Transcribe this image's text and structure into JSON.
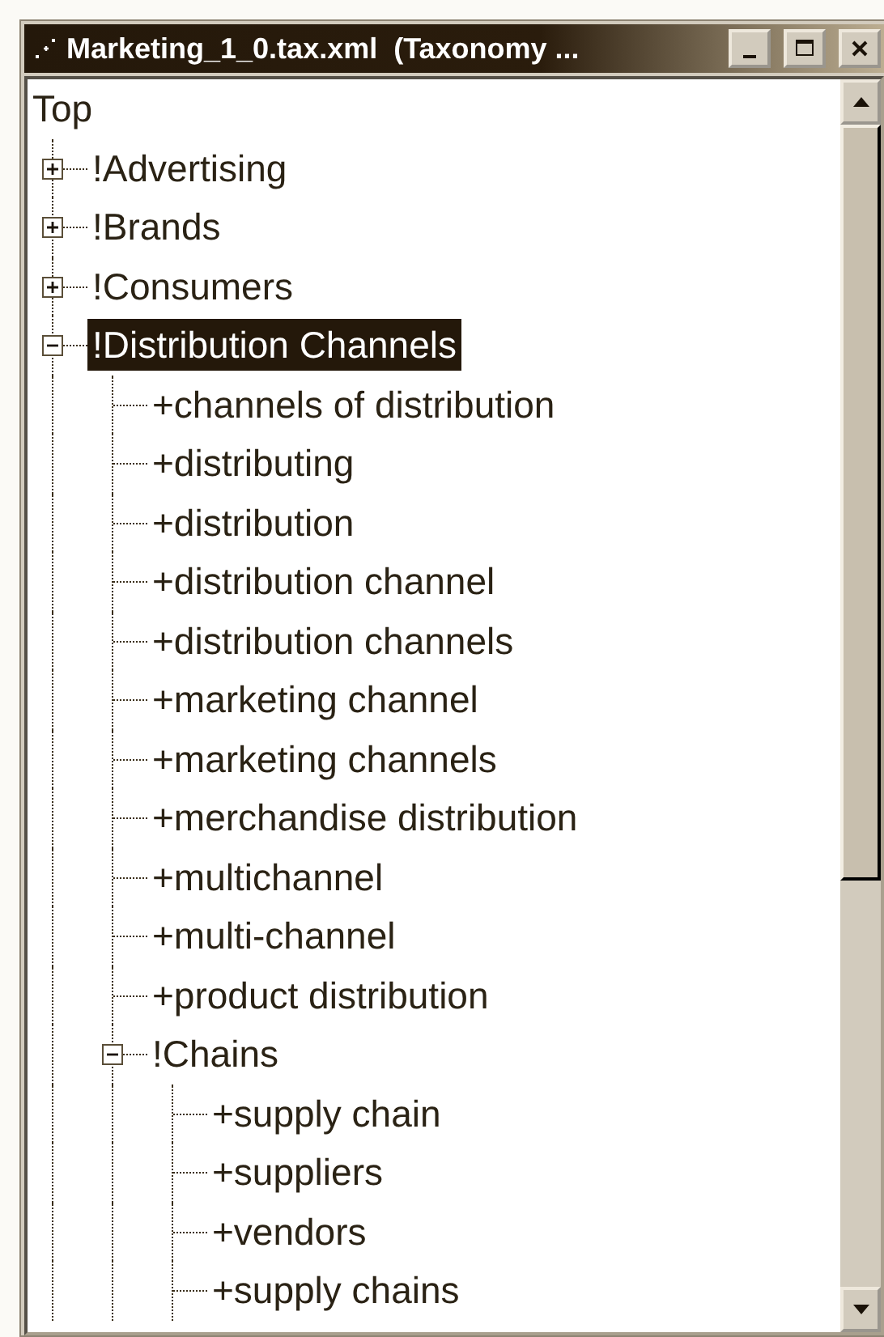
{
  "window": {
    "title": "Marketing_1_0.tax.xml  (Taxonomy ..."
  },
  "tree": {
    "label": "Top",
    "children": [
      {
        "label": "!Advertising",
        "expanded": false,
        "selected": false
      },
      {
        "label": "!Brands",
        "expanded": false,
        "selected": false
      },
      {
        "label": "!Consumers",
        "expanded": false,
        "selected": false
      },
      {
        "label": "!Distribution Channels",
        "expanded": true,
        "selected": true,
        "children": [
          {
            "label": "+channels of distribution",
            "selected": false
          },
          {
            "label": "+distributing",
            "selected": false
          },
          {
            "label": "+distribution",
            "selected": false
          },
          {
            "label": "+distribution channel",
            "selected": false
          },
          {
            "label": "+distribution channels",
            "selected": false
          },
          {
            "label": "+marketing channel",
            "selected": false
          },
          {
            "label": "+marketing channels",
            "selected": false
          },
          {
            "label": "+merchandise distribution",
            "selected": false
          },
          {
            "label": "+multichannel",
            "selected": false
          },
          {
            "label": "+multi-channel",
            "selected": false
          },
          {
            "label": "+product distribution",
            "selected": false
          },
          {
            "label": "!Chains",
            "expanded": true,
            "selected": false,
            "children": [
              {
                "label": "+supply chain",
                "selected": false
              },
              {
                "label": "+suppliers",
                "selected": false
              },
              {
                "label": "+vendors",
                "selected": false
              },
              {
                "label": "+supply chains",
                "selected": false
              }
            ]
          }
        ]
      }
    ]
  }
}
